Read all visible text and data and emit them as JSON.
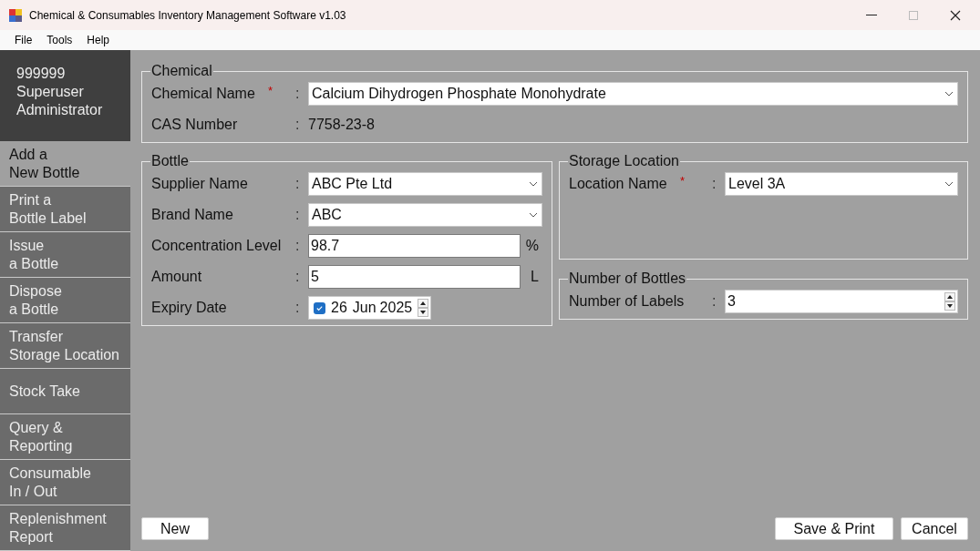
{
  "window": {
    "title": "Chemical & Consumables Inventory Management Software v1.03"
  },
  "menu": [
    "File",
    "Tools",
    "Help"
  ],
  "user": {
    "id": "999999",
    "role": "Superuser",
    "name": "Administrator"
  },
  "sidebar": {
    "items": [
      {
        "line1": "Add a",
        "line2": "New Bottle",
        "selected": true
      },
      {
        "line1": "Print a",
        "line2": "Bottle Label",
        "selected": false
      },
      {
        "line1": "Issue",
        "line2": "a Bottle",
        "selected": false
      },
      {
        "line1": "Dispose",
        "line2": "a Bottle",
        "selected": false
      },
      {
        "line1": "Transfer",
        "line2": "Storage Location",
        "selected": false
      },
      {
        "line1": "Stock Take",
        "selected": false
      },
      {
        "line1": "Query &",
        "line2": "Reporting",
        "selected": false
      },
      {
        "line1": "Consumable",
        "line2": "In / Out",
        "selected": false
      },
      {
        "line1": "Replenishment",
        "line2": "Report",
        "selected": false
      }
    ]
  },
  "groups": {
    "chemical": {
      "title": "Chemical",
      "fields": [
        {
          "kind": "combo",
          "label": "Chemical Name",
          "required_mark": "*",
          "colon": ":",
          "value": "Calcium Dihydrogen Phosphate Monohydrate"
        },
        {
          "kind": "readonly",
          "label": "CAS Number",
          "colon": ":",
          "value": "7758-23-8"
        }
      ]
    },
    "bottle": {
      "title": "Bottle",
      "fields": [
        {
          "kind": "combo",
          "label": "Supplier Name",
          "colon": ":",
          "value": "ABC Pte Ltd"
        },
        {
          "kind": "combo",
          "label": "Brand Name",
          "colon": ":",
          "value": "ABC"
        },
        {
          "kind": "text",
          "label": "Concentration Level",
          "colon": ":",
          "value": "98.7",
          "unit": "%"
        },
        {
          "kind": "text",
          "label": "Amount",
          "colon": ":",
          "value": "5",
          "unit": "L"
        },
        {
          "kind": "date",
          "label": "Expiry Date",
          "colon": ":",
          "checked": true,
          "day": "26",
          "month": "Jun",
          "year": "2025"
        }
      ]
    },
    "storage": {
      "title": "Storage Location",
      "fields": [
        {
          "kind": "combo",
          "label": "Location Name",
          "required_mark": "*",
          "colon": ":",
          "value": "Level 3A"
        }
      ]
    },
    "count": {
      "title": "Number of Bottles",
      "fields": [
        {
          "kind": "number",
          "label": "Number of Labels",
          "colon": ":",
          "value": "3"
        }
      ]
    }
  },
  "buttons": {
    "left": [
      "New"
    ],
    "right": [
      "Save & Print",
      "Cancel"
    ]
  }
}
